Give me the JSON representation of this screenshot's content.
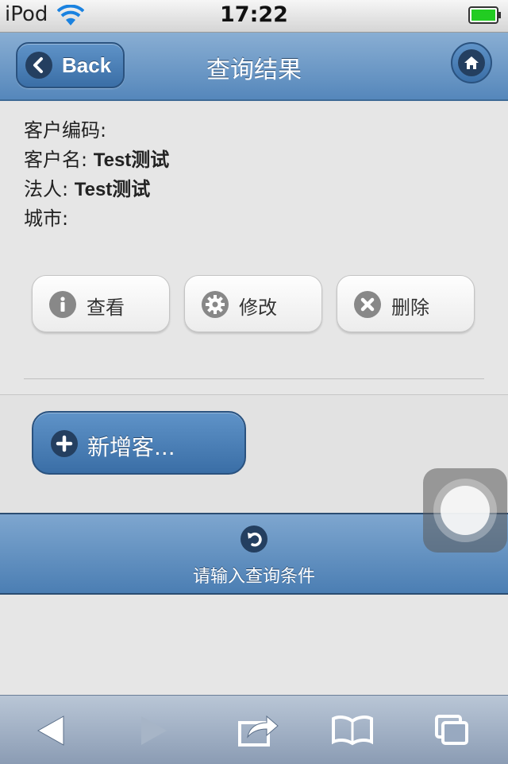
{
  "status_bar": {
    "carrier": "iPod",
    "time": "17:22",
    "battery_color": "#22cc22"
  },
  "header": {
    "back_label": "Back",
    "title": "查询结果",
    "back_icon": "chevron-left-icon",
    "home_icon": "home-icon"
  },
  "customer": {
    "code_label": "客户编码:",
    "code_value": "",
    "name_label": "客户名:",
    "name_value": "Test测试",
    "legal_label": "法人:",
    "legal_value": "Test测试",
    "city_label": "城市:",
    "city_value": ""
  },
  "actions": {
    "view_label": "查看",
    "edit_label": "修改",
    "delete_label": "删除"
  },
  "add_button": {
    "label": "新增客..."
  },
  "footer": {
    "label": "请输入查询条件"
  },
  "colors": {
    "header_top": "#89aed3",
    "header_bottom": "#5587bb",
    "button_blue": "#3a6ea6"
  }
}
